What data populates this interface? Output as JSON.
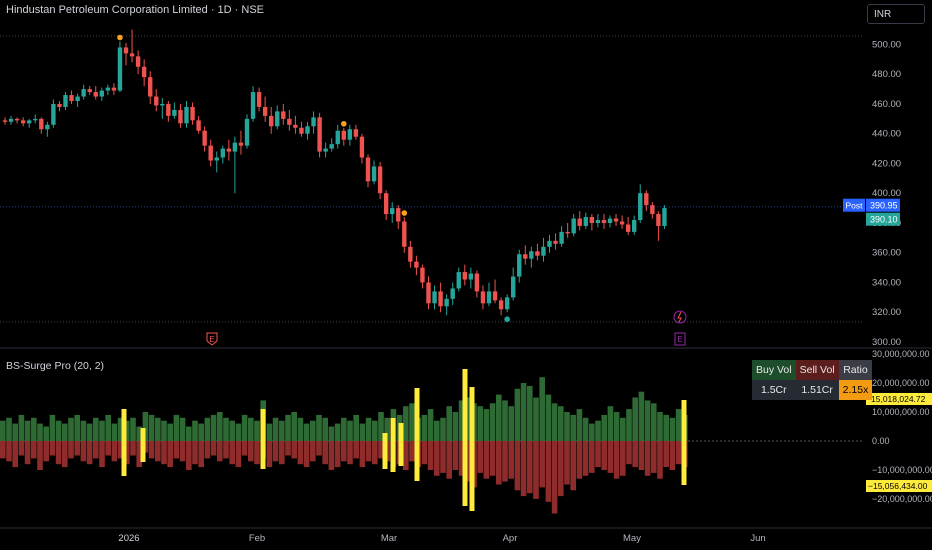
{
  "title": "Hindustan Petroleum Corporation Limited · 1D · NSE",
  "currency": "INR",
  "indicator_title": "BS-Surge Pro (20, 2)",
  "colors": {
    "up": "#26a69a",
    "down": "#ef5350",
    "surge": "#ffeb3b",
    "buy": "#2e6b34",
    "sell": "#8e2b2b",
    "post": "#2962ff",
    "dot": "#f7a31c",
    "earn": "#ef5350",
    "earn2": "#9c27b0"
  },
  "table": {
    "headers": [
      "Buy Vol",
      "Sell Vol",
      "Ratio"
    ],
    "values": [
      "1.5Cr",
      "1.51Cr",
      "2.15x"
    ]
  },
  "labels": {
    "post_tag": "Post",
    "post_price": "390.95",
    "last_price": "390.10",
    "buy_value": "15,018,024.72",
    "sell_value": "−15,056,434.00"
  },
  "earnings_labels": [
    "E",
    "E"
  ],
  "price_axis": [
    "500.00",
    "480.00",
    "460.00",
    "440.00",
    "420.00",
    "400.00",
    "380.00",
    "360.00",
    "340.00",
    "320.00",
    "300.00"
  ],
  "indicator_axis": [
    "30,000,000.00",
    "20,000,000.00",
    "10,000,000.00",
    "0.00",
    "−10,000,000.00",
    "−20,000,000.00"
  ],
  "time_axis": [
    "2026",
    "Feb",
    "Mar",
    "Apr",
    "May",
    "Jun"
  ],
  "chart_data": [
    {
      "type": "candlestick",
      "title": "Hindustan Petroleum Corporation Limited · 1D · NSE",
      "ylim": [
        300,
        510
      ],
      "ohlc": [
        [
          449,
          451,
          446,
          448
        ],
        [
          448,
          452,
          446,
          450
        ],
        [
          450,
          451,
          447,
          449
        ],
        [
          449,
          451,
          445,
          447
        ],
        [
          447,
          450,
          444,
          449
        ],
        [
          449,
          453,
          447,
          450
        ],
        [
          450,
          451,
          440,
          443
        ],
        [
          443,
          448,
          438,
          446
        ],
        [
          446,
          463,
          444,
          460
        ],
        [
          460,
          462,
          455,
          458
        ],
        [
          458,
          468,
          456,
          466
        ],
        [
          466,
          469,
          460,
          462
        ],
        [
          462,
          467,
          458,
          465
        ],
        [
          465,
          473,
          463,
          470
        ],
        [
          470,
          472,
          466,
          468
        ],
        [
          468,
          472,
          463,
          465
        ],
        [
          465,
          471,
          462,
          469
        ],
        [
          469,
          473,
          466,
          471
        ],
        [
          471,
          474,
          466,
          469
        ],
        [
          469,
          502,
          468,
          498
        ],
        [
          498,
          501,
          486,
          494
        ],
        [
          494,
          510,
          488,
          492
        ],
        [
          492,
          496,
          480,
          485
        ],
        [
          485,
          490,
          472,
          478
        ],
        [
          478,
          482,
          460,
          465
        ],
        [
          465,
          470,
          455,
          459
        ],
        [
          459,
          464,
          450,
          460
        ],
        [
          460,
          462,
          448,
          452
        ],
        [
          452,
          461,
          450,
          456
        ],
        [
          456,
          460,
          444,
          447
        ],
        [
          447,
          462,
          444,
          458
        ],
        [
          458,
          461,
          446,
          449
        ],
        [
          449,
          452,
          440,
          442
        ],
        [
          442,
          445,
          428,
          432
        ],
        [
          432,
          436,
          418,
          422
        ],
        [
          422,
          428,
          414,
          424
        ],
        [
          424,
          432,
          420,
          430
        ],
        [
          430,
          436,
          422,
          428
        ],
        [
          428,
          438,
          400,
          434
        ],
        [
          434,
          442,
          426,
          432
        ],
        [
          432,
          453,
          430,
          450
        ],
        [
          450,
          472,
          448,
          468
        ],
        [
          468,
          471,
          455,
          458
        ],
        [
          458,
          465,
          448,
          452
        ],
        [
          452,
          458,
          440,
          445
        ],
        [
          445,
          459,
          443,
          455
        ],
        [
          455,
          460,
          446,
          450
        ],
        [
          450,
          456,
          442,
          446
        ],
        [
          446,
          452,
          440,
          444
        ],
        [
          444,
          448,
          438,
          440
        ],
        [
          440,
          448,
          436,
          445
        ],
        [
          445,
          455,
          440,
          451
        ],
        [
          451,
          454,
          424,
          428
        ],
        [
          428,
          434,
          424,
          430
        ],
        [
          430,
          437,
          428,
          433
        ],
        [
          433,
          446,
          430,
          442
        ],
        [
          442,
          444,
          432,
          436
        ],
        [
          436,
          446,
          432,
          443
        ],
        [
          443,
          446,
          436,
          438
        ],
        [
          438,
          440,
          420,
          424
        ],
        [
          424,
          426,
          404,
          408
        ],
        [
          408,
          422,
          406,
          418
        ],
        [
          418,
          421,
          396,
          400
        ],
        [
          400,
          402,
          382,
          386
        ],
        [
          386,
          394,
          380,
          390
        ],
        [
          390,
          392,
          376,
          381
        ],
        [
          381,
          384,
          360,
          364
        ],
        [
          364,
          368,
          350,
          354
        ],
        [
          354,
          358,
          345,
          350
        ],
        [
          350,
          352,
          336,
          340
        ],
        [
          340,
          344,
          322,
          326
        ],
        [
          326,
          338,
          322,
          334
        ],
        [
          334,
          340,
          320,
          324
        ],
        [
          324,
          332,
          318,
          329
        ],
        [
          329,
          340,
          325,
          336
        ],
        [
          336,
          350,
          334,
          347
        ],
        [
          347,
          352,
          338,
          342
        ],
        [
          342,
          350,
          336,
          346
        ],
        [
          346,
          348,
          330,
          334
        ],
        [
          334,
          338,
          322,
          326
        ],
        [
          326,
          340,
          324,
          334
        ],
        [
          334,
          342,
          326,
          328
        ],
        [
          328,
          330,
          318,
          322
        ],
        [
          322,
          332,
          320,
          330
        ],
        [
          330,
          350,
          328,
          344
        ],
        [
          344,
          362,
          340,
          359
        ],
        [
          359,
          365,
          352,
          356
        ],
        [
          356,
          364,
          350,
          361
        ],
        [
          361,
          366,
          355,
          358
        ],
        [
          358,
          370,
          354,
          364
        ],
        [
          364,
          372,
          360,
          368
        ],
        [
          368,
          373,
          362,
          366
        ],
        [
          366,
          378,
          364,
          374
        ],
        [
          374,
          380,
          370,
          373
        ],
        [
          373,
          386,
          371,
          383
        ],
        [
          383,
          388,
          375,
          378
        ],
        [
          378,
          387,
          376,
          384
        ],
        [
          384,
          386,
          375,
          380
        ],
        [
          380,
          386,
          377,
          382
        ],
        [
          382,
          386,
          376,
          380
        ],
        [
          380,
          385,
          377,
          383
        ],
        [
          383,
          386,
          378,
          381
        ],
        [
          381,
          385,
          376,
          379
        ],
        [
          379,
          384,
          372,
          374
        ],
        [
          374,
          385,
          372,
          382
        ],
        [
          382,
          406,
          380,
          400
        ],
        [
          400,
          402,
          388,
          392
        ],
        [
          392,
          394,
          383,
          386
        ],
        [
          386,
          388,
          368,
          378
        ],
        [
          378,
          392,
          376,
          390
        ]
      ],
      "markers_dots_at_index": [
        19,
        56,
        66
      ],
      "earnings_at_index": [
        33,
        110
      ]
    },
    {
      "type": "bar",
      "title": "BS-Surge Pro (20, 2)",
      "series": [
        {
          "name": "Buy Vol",
          "values": [
            7,
            8,
            6,
            9,
            7,
            8,
            6,
            5,
            9,
            7,
            6,
            8,
            9,
            7,
            6,
            8,
            7,
            9,
            6,
            8,
            7,
            8,
            5,
            10,
            9,
            8,
            7,
            6,
            9,
            8,
            5,
            7,
            6,
            8,
            9,
            10,
            8,
            7,
            6,
            9,
            8,
            7,
            14,
            6,
            8,
            7,
            9,
            10,
            8,
            6,
            7,
            9,
            8,
            5,
            6,
            8,
            7,
            9,
            6,
            8,
            7,
            10,
            8,
            11,
            9,
            12,
            13,
            8,
            9,
            11,
            7,
            8,
            12,
            10,
            14,
            15,
            13,
            12,
            11,
            13,
            16,
            14,
            12,
            18,
            20,
            19,
            15,
            22,
            16,
            13,
            12,
            10,
            9,
            11,
            8,
            6,
            7,
            9,
            12,
            10,
            8,
            11,
            15,
            17,
            14,
            13,
            10,
            9,
            8,
            11,
            9
          ]
        },
        {
          "name": "Sell Vol",
          "values": [
            6,
            7,
            9,
            5,
            8,
            6,
            10,
            7,
            5,
            8,
            9,
            6,
            5,
            7,
            8,
            6,
            9,
            5,
            7,
            6,
            8,
            5,
            9,
            4,
            6,
            7,
            8,
            9,
            6,
            7,
            10,
            8,
            9,
            6,
            5,
            7,
            6,
            8,
            9,
            5,
            7,
            8,
            6,
            9,
            7,
            8,
            5,
            6,
            8,
            9,
            7,
            5,
            8,
            10,
            9,
            7,
            8,
            6,
            9,
            7,
            8,
            6,
            7,
            9,
            8,
            10,
            7,
            9,
            8,
            10,
            12,
            11,
            13,
            10,
            12,
            14,
            16,
            11,
            13,
            12,
            15,
            14,
            13,
            17,
            19,
            18,
            20,
            16,
            21,
            25,
            19,
            15,
            17,
            13,
            12,
            11,
            9,
            10,
            11,
            13,
            12,
            8,
            9,
            10,
            12,
            11,
            13,
            9,
            10,
            8,
            9
          ]
        },
        {
          "name": "Surge",
          "values": [
            [
              7,
              2.25
            ],
            [
              10,
              1.125
            ],
            [
              29,
              2.0
            ],
            [
              41,
              1.75
            ],
            [
              53,
              1.25
            ],
            [
              54,
              2.0
            ],
            [
              55,
              1.25
            ],
            [
              56,
              2.125
            ],
            [
              57,
              1.5
            ],
            [
              58,
              2.5
            ],
            [
              59,
              3.25
            ],
            [
              61,
              1.75
            ],
            [
              65,
              3.375
            ],
            [
              66,
              1.25
            ],
            [
              67,
              2.625
            ],
            [
              77,
              2.125
            ]
          ]
        }
      ]
    }
  ]
}
